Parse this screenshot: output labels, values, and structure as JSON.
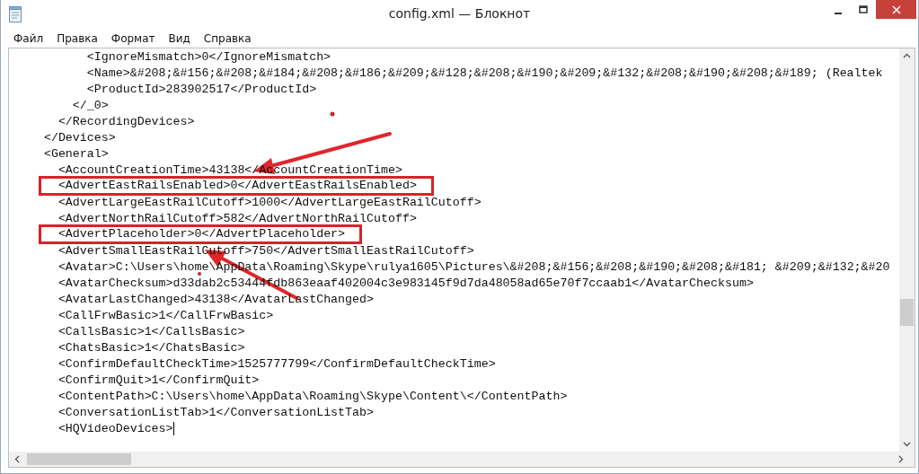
{
  "window": {
    "title": "config.xml — Блокнот"
  },
  "menu": [
    {
      "label": "Файл"
    },
    {
      "label": "Правка"
    },
    {
      "label": "Формат"
    },
    {
      "label": "Вид"
    },
    {
      "label": "Справка"
    }
  ],
  "lines": [
    {
      "text": "          <IgnoreMismatch>0</IgnoreMismatch>",
      "highlighted": false
    },
    {
      "text": "          <Name>&#208;&#156;&#208;&#184;&#208;&#186;&#209;&#128;&#208;&#190;&#209;&#132;&#208;&#190;&#208;&#189; (Realtek",
      "highlighted": false
    },
    {
      "text": "          <ProductId>283902517</ProductId>",
      "highlighted": false
    },
    {
      "text": "        </_0>",
      "highlighted": false
    },
    {
      "text": "      </RecordingDevices>",
      "highlighted": false
    },
    {
      "text": "    </Devices>",
      "highlighted": false
    },
    {
      "text": "    <General>",
      "highlighted": false
    },
    {
      "text": "      <AccountCreationTime>43138</AccountCreationTime>",
      "highlighted": false
    },
    {
      "text": "      <AdvertEastRailsEnabled>0</AdvertEastRailsEnabled>",
      "highlighted": true
    },
    {
      "text": "      <AdvertLargeEastRailCutoff>1000</AdvertLargeEastRailCutoff>",
      "highlighted": false
    },
    {
      "text": "      <AdvertNorthRailCutoff>582</AdvertNorthRailCutoff>",
      "highlighted": false
    },
    {
      "text": "      <AdvertPlaceholder>0</AdvertPlaceholder>",
      "highlighted": true
    },
    {
      "text": "      <AdvertSmallEastRailCutoff>750</AdvertSmallEastRailCutoff>",
      "highlighted": false
    },
    {
      "text": "      <Avatar>C:\\Users\\home\\AppData\\Roaming\\Skype\\rulya1605\\Pictures\\&#208;&#156;&#208;&#190;&#208;&#181; &#209;&#132;&#20",
      "highlighted": false
    },
    {
      "text": "      <AvatarChecksum>d33dab2c53444fdb863eaaf402004c3e983145f9d7da48058ad65e70f7ccaab1</AvatarChecksum>",
      "highlighted": false
    },
    {
      "text": "      <AvatarLastChanged>43138</AvatarLastChanged>",
      "highlighted": false
    },
    {
      "text": "      <CallFrwBasic>1</CallFrwBasic>",
      "highlighted": false
    },
    {
      "text": "      <CallsBasic>1</CallsBasic>",
      "highlighted": false
    },
    {
      "text": "      <ChatsBasic>1</ChatsBasic>",
      "highlighted": false
    },
    {
      "text": "      <ConfirmDefaultCheckTime>1525777799</ConfirmDefaultCheckTime>",
      "highlighted": false
    },
    {
      "text": "      <ConfirmQuit>1</ConfirmQuit>",
      "highlighted": false
    },
    {
      "text": "      <ContentPath>C:\\Users\\home\\AppData\\Roaming\\Skype\\Content\\</ContentPath>",
      "highlighted": false
    },
    {
      "text": "      <ConversationListTab>1</ConversationListTab>",
      "highlighted": false
    },
    {
      "text": "      <HQVideoDevices>",
      "highlighted": false,
      "caret": true
    }
  ]
}
